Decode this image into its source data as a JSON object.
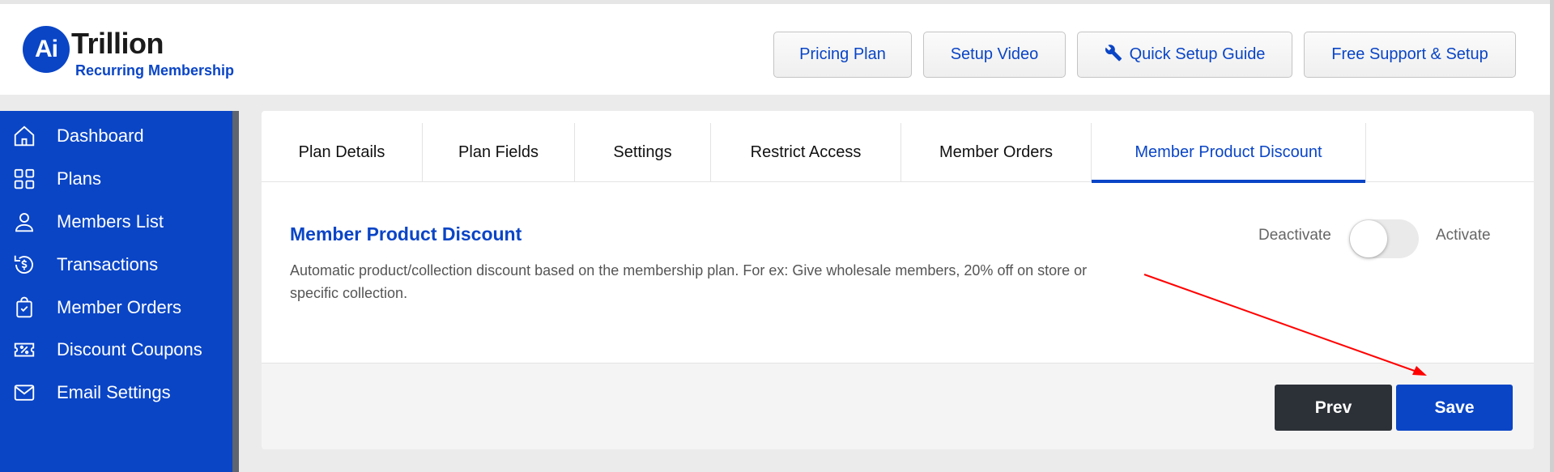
{
  "logo": {
    "mark": "Ai",
    "title": "Trillion",
    "subtitle": "Recurring Membership"
  },
  "header_buttons": {
    "pricing": "Pricing Plan",
    "setup_video": "Setup Video",
    "quick_setup": "Quick Setup Guide",
    "support": "Free Support & Setup"
  },
  "sidebar": {
    "items": [
      {
        "label": "Dashboard",
        "icon": "home-icon"
      },
      {
        "label": "Plans",
        "icon": "grid-icon"
      },
      {
        "label": "Members List",
        "icon": "user-icon"
      },
      {
        "label": "Transactions",
        "icon": "dollar-refresh-icon"
      },
      {
        "label": "Member Orders",
        "icon": "bag-check-icon"
      },
      {
        "label": "Discount Coupons",
        "icon": "coupon-icon"
      },
      {
        "label": "Email Settings",
        "icon": "mail-icon"
      }
    ]
  },
  "tabs": [
    {
      "label": "Plan Details"
    },
    {
      "label": "Plan Fields"
    },
    {
      "label": "Settings"
    },
    {
      "label": "Restrict Access"
    },
    {
      "label": "Member Orders"
    },
    {
      "label": "Member Product Discount",
      "active": true
    }
  ],
  "section": {
    "title": "Member Product Discount",
    "description": "Automatic product/collection discount based on the membership plan. For ex: Give wholesale members, 20% off on store or specific collection."
  },
  "toggle": {
    "off_label": "Deactivate",
    "on_label": "Activate",
    "state": "off"
  },
  "footer": {
    "prev_label": "Prev",
    "save_label": "Save"
  },
  "colors": {
    "brand": "#0a45c6",
    "dark_button": "#2c3138",
    "annotation_arrow": "#ff0000"
  }
}
